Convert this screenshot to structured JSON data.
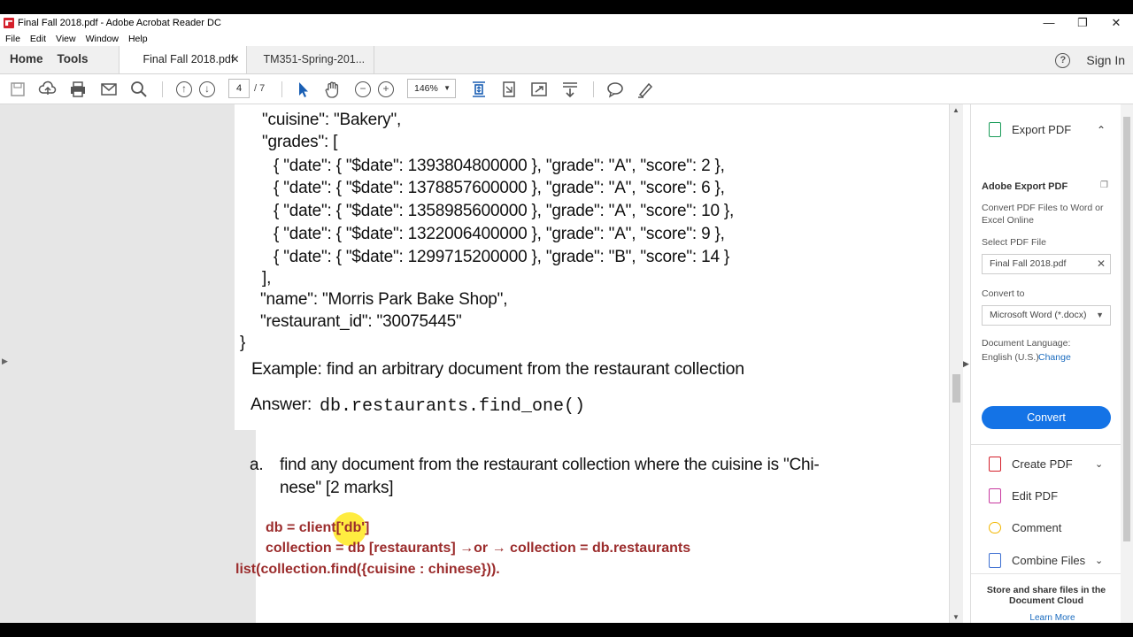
{
  "window": {
    "title": "Final Fall 2018.pdf - Adobe Acrobat Reader DC",
    "minimize": "—",
    "maximize": "❐",
    "close": "✕"
  },
  "menu": [
    "File",
    "Edit",
    "View",
    "Window",
    "Help"
  ],
  "tabs": {
    "home": "Home",
    "tools": "Tools",
    "doc1": "Final Fall 2018.pdf",
    "doc2": "TM351-Spring-201...",
    "sign_in": "Sign In"
  },
  "toolbar": {
    "page_current": "4",
    "page_total": "/ 7",
    "zoom": "146%"
  },
  "document": {
    "lines": [
      "\"cuisine\": \"Bakery\",",
      "\"grades\": [",
      "{ \"date\": { \"$date\": 1393804800000 }, \"grade\": \"A\", \"score\": 2 },",
      "{ \"date\": { \"$date\": 1378857600000 }, \"grade\": \"A\", \"score\": 6 },",
      "{ \"date\": { \"$date\": 1358985600000 }, \"grade\": \"A\", \"score\": 10 },",
      "{ \"date\": { \"$date\": 1322006400000 }, \"grade\": \"A\", \"score\": 9 },",
      "{ \"date\": { \"$date\": 1299715200000 }, \"grade\": \"B\", \"score\": 14 }",
      "],",
      "\"name\": \"Morris Park Bake Shop\",",
      "\"restaurant_id\": \"30075445\"",
      "}"
    ],
    "example": "Example: find an arbitrary document from the restaurant collection",
    "answer_label": "Answer:",
    "answer_code": "db.restaurants.find_one()",
    "q_marker": "a.",
    "q_line1": "find any document from the restaurant collection where the cuisine is \"Chi-",
    "q_line2": "nese\" [2 marks]",
    "ans_line1": "db = client['db']",
    "ans_line2": "collection = db [restaurants] →or → collection = db.restaurants",
    "ans_line3": "list(collection.find({cuisine : chinese}))."
  },
  "panel": {
    "export_pdf": "Export PDF",
    "title": "Adobe Export PDF",
    "description": "Convert PDF Files to Word or Excel Online",
    "select_label": "Select PDF File",
    "selected_file": "Final Fall 2018.pdf",
    "convert_to_label": "Convert to",
    "convert_to_value": "Microsoft Word (*.docx)",
    "language_label": "Document Language:",
    "language_value": "English (U.S.)",
    "change_link": "Change",
    "convert_button": "Convert",
    "tools": [
      "Create PDF",
      "Edit PDF",
      "Comment",
      "Combine Files"
    ],
    "store_text": "Store and share files in the Document Cloud",
    "learn_more": "Learn More"
  },
  "colors": {
    "accent": "#1473e6",
    "answer_red": "#9b2c2c",
    "create_pdf": "#d4202b",
    "edit_pdf": "#c83aa0",
    "comment": "#f2b600",
    "combine": "#3d6fd1",
    "export": "#1b9c5a"
  },
  "icons": [
    "save-icon",
    "upload-icon",
    "print-icon",
    "email-icon",
    "search-icon",
    "page-up-icon",
    "page-down-icon",
    "select-cursor-icon",
    "hand-icon",
    "zoom-out-icon",
    "zoom-in-icon",
    "fit-page-icon",
    "rotate-icon",
    "fullscreen-icon",
    "read-mode-icon",
    "comment-icon",
    "highlight-icon",
    "help-icon"
  ]
}
